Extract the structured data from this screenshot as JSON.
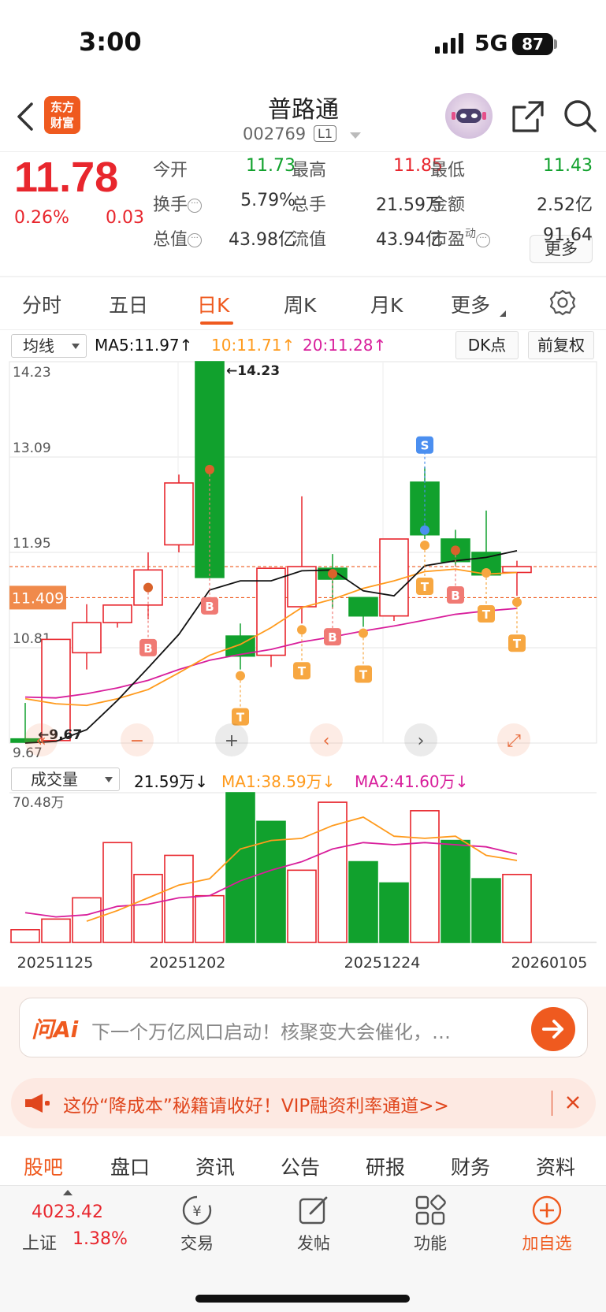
{
  "status": {
    "time": "3:00",
    "network": "5G",
    "battery": "87"
  },
  "header": {
    "brand_logo_text": "东方\n财富",
    "stock_name": "普路通",
    "stock_code": "002769",
    "level_badge": "L1"
  },
  "quote": {
    "price": "11.78",
    "change_pct": "0.26%",
    "change": "0.03",
    "rows": [
      [
        {
          "label": "今开",
          "value": "11.73",
          "color": "green"
        },
        {
          "label": "最高",
          "value": "11.85",
          "color": "red"
        },
        {
          "label": "最低",
          "value": "11.43",
          "color": "green"
        }
      ],
      [
        {
          "label": "换手",
          "value": "5.79%",
          "color": "dark"
        },
        {
          "label": "总手",
          "value": "21.59万",
          "color": "dark"
        },
        {
          "label": "金额",
          "value": "2.52亿",
          "color": "dark"
        }
      ],
      [
        {
          "label": "总值",
          "value": "43.98亿",
          "color": "dark"
        },
        {
          "label": "流值",
          "value": "43.94亿",
          "color": "dark"
        },
        {
          "label": "市盈",
          "label_sup": "动",
          "value": "91.64",
          "color": "dark"
        }
      ]
    ],
    "more_label": "更多"
  },
  "period_tabs": [
    "分时",
    "五日",
    "日K",
    "周K",
    "月K",
    "更多"
  ],
  "active_period": "日K",
  "chart_toolbar": {
    "indicator": "均线",
    "ma5": "MA5:11.97↑",
    "ma10": "10:11.71↑",
    "ma20": "20:11.28↑",
    "dk_button": "DK点",
    "adjust_button": "前复权",
    "volume_indicator": "成交量",
    "volume_value": "21.59万↓",
    "vol_ma1": "MA1:38.59万↓",
    "vol_ma2": "MA2:41.60万↓"
  },
  "chart_controls": [
    "«",
    "−",
    "+",
    "‹",
    "›",
    "⤢"
  ],
  "colors": {
    "up": "#e8262d",
    "down": "#11a12d",
    "accent": "#ef5a1f",
    "ma5": "#111111",
    "ma10": "#ff9a1c",
    "ma20": "#d81e9b",
    "vol_ma1": "#ff9a1c",
    "vol_ma2": "#d81e9b"
  },
  "chart_data": [
    {
      "type": "candlestick",
      "y_tick_labels": [
        "14.23",
        "13.09",
        "11.95",
        "10.81",
        "9.67"
      ],
      "ylim": [
        9.67,
        14.23
      ],
      "max_label": "←14.23",
      "min_label": "←9.67",
      "crosshair_label": "11.409",
      "x_tick_labels": [
        "20251125",
        "20251202",
        "20251224",
        "20260105"
      ],
      "candles": [
        {
          "o": 9.72,
          "h": 10.15,
          "l": 9.67,
          "c": 9.68
        },
        {
          "o": 9.7,
          "h": 10.91,
          "l": 9.7,
          "c": 10.91
        },
        {
          "o": 10.75,
          "h": 11.33,
          "l": 10.55,
          "c": 11.11
        },
        {
          "o": 11.11,
          "h": 11.3,
          "l": 11.05,
          "c": 11.32
        },
        {
          "o": 11.32,
          "h": 11.95,
          "l": 11.15,
          "c": 11.74
        },
        {
          "o": 12.04,
          "h": 12.88,
          "l": 11.95,
          "c": 12.78
        },
        {
          "o": 14.23,
          "h": 14.23,
          "l": 11.65,
          "c": 11.65
        },
        {
          "o": 10.95,
          "h": 11.1,
          "l": 10.55,
          "c": 10.71
        },
        {
          "o": 10.72,
          "h": 11.76,
          "l": 10.58,
          "c": 11.76
        },
        {
          "o": 11.3,
          "h": 12.62,
          "l": 11.1,
          "c": 11.78
        },
        {
          "o": 11.76,
          "h": 11.93,
          "l": 11.28,
          "c": 11.63
        },
        {
          "o": 11.41,
          "h": 11.41,
          "l": 11.06,
          "c": 11.19
        },
        {
          "o": 11.19,
          "h": 12.11,
          "l": 11.13,
          "c": 12.11
        },
        {
          "o": 12.79,
          "h": 12.97,
          "l": 12.11,
          "c": 12.16
        },
        {
          "o": 12.11,
          "h": 12.22,
          "l": 11.78,
          "c": 11.84
        },
        {
          "o": 11.95,
          "h": 12.45,
          "l": 11.78,
          "c": 11.68
        },
        {
          "o": 11.71,
          "h": 11.85,
          "l": 11.43,
          "c": 11.78
        }
      ],
      "ma5": [
        9.67,
        9.69,
        9.83,
        10.18,
        10.57,
        10.97,
        11.5,
        11.61,
        11.61,
        11.73,
        11.74,
        11.49,
        11.43,
        11.79,
        11.85,
        11.89,
        11.97
      ],
      "ma10": [
        10.2,
        10.14,
        10.12,
        10.2,
        10.31,
        10.51,
        10.72,
        10.85,
        11.05,
        11.29,
        11.39,
        11.52,
        11.61,
        11.72,
        11.75,
        11.69,
        11.71
      ],
      "ma20": [
        10.22,
        10.21,
        10.26,
        10.33,
        10.42,
        10.55,
        10.66,
        10.73,
        10.79,
        10.88,
        10.94,
        11.01,
        11.07,
        11.14,
        11.21,
        11.25,
        11.28
      ],
      "signals": [
        {
          "i": 4,
          "type": "B"
        },
        {
          "i": 6,
          "type": "B"
        },
        {
          "i": 7,
          "type": "T"
        },
        {
          "i": 9,
          "type": "T"
        },
        {
          "i": 10,
          "type": "B"
        },
        {
          "i": 11,
          "type": "T"
        },
        {
          "i": 13,
          "type": "S"
        },
        {
          "i": 13,
          "type": "T"
        },
        {
          "i": 14,
          "type": "B"
        },
        {
          "i": 15,
          "type": "T"
        },
        {
          "i": 16,
          "type": "T"
        }
      ]
    },
    {
      "type": "bar",
      "y_tick_labels": [
        "70.48万"
      ],
      "ylim": [
        0,
        70.48
      ],
      "volumes": [
        6,
        11,
        21,
        47,
        32,
        41,
        22,
        70.48,
        57,
        34,
        66,
        38,
        28,
        62,
        48,
        30,
        32
      ],
      "vol_up": [
        true,
        true,
        true,
        true,
        true,
        true,
        true,
        false,
        false,
        true,
        true,
        false,
        false,
        true,
        false,
        false,
        true
      ],
      "ma1": [
        null,
        null,
        10,
        15,
        21,
        27,
        30,
        44,
        48,
        49,
        55,
        59,
        50,
        49,
        50,
        41,
        38.59
      ],
      "ma2": [
        14,
        12,
        13,
        17,
        18,
        21,
        22,
        29,
        34,
        38,
        44,
        47,
        46,
        47,
        46,
        45,
        41.6
      ]
    }
  ],
  "ai": {
    "logo": "问Ai",
    "prompt": "下一个万亿风口启动！核聚变大会催化，…"
  },
  "promo": {
    "text": "这份“降成本”秘籍请收好！VIP融资利率通道>>"
  },
  "content_tabs": [
    "股吧",
    "盘口",
    "资讯",
    "公告",
    "研报",
    "财务",
    "资料"
  ],
  "active_content_tab": "股吧",
  "index": {
    "value": "4023.42",
    "name": "上证",
    "pct": "1.38%"
  },
  "bottom_nav": [
    {
      "label": "交易",
      "icon": "trade-icon"
    },
    {
      "label": "发帖",
      "icon": "post-icon"
    },
    {
      "label": "功能",
      "icon": "apps-icon"
    },
    {
      "label": "加自选",
      "icon": "add-watchlist-icon"
    }
  ]
}
